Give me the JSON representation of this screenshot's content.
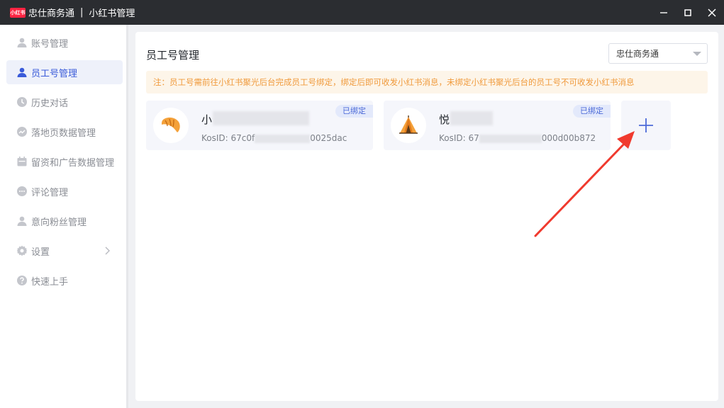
{
  "titlebar": {
    "logo_text": "小红书",
    "app_name": "忠仕商务通",
    "separator": "|",
    "subtitle": "小红书管理"
  },
  "sidebar": {
    "items": [
      {
        "label": "账号管理",
        "icon": "user-icon",
        "active": false
      },
      {
        "label": "员工号管理",
        "icon": "user-icon",
        "active": true
      },
      {
        "label": "历史对话",
        "icon": "clock-icon",
        "active": false
      },
      {
        "label": "落地页数据管理",
        "icon": "chart-icon",
        "active": false
      },
      {
        "label": "留资和广告数据管理",
        "icon": "calendar-icon",
        "active": false
      },
      {
        "label": "评论管理",
        "icon": "comment-icon",
        "active": false
      },
      {
        "label": "意向粉丝管理",
        "icon": "user-icon",
        "active": false
      },
      {
        "label": "设置",
        "icon": "gear-icon",
        "active": false
      },
      {
        "label": "快速上手",
        "icon": "help-icon",
        "active": false
      }
    ]
  },
  "main": {
    "title": "员工号管理",
    "company_select": "忠仕商务通",
    "notice": "注：员工号需前往小红书聚光后台完成员工号绑定，绑定后即可收发小红书消息，未绑定小红书聚光后台的员工号不可收发小红书消息",
    "cards": [
      {
        "name": "小",
        "kos_prefix": "KosID: 67c0f",
        "kos_suffix": "0025dac",
        "badge": "已绑定",
        "avatar": "croissant-icon"
      },
      {
        "name": "悦",
        "kos_prefix": "KosID: 67",
        "kos_suffix": "000d00b872",
        "badge": "已绑定",
        "avatar": "tent-icon"
      }
    ]
  },
  "colors": {
    "accent": "#3a5bd9",
    "notice_text": "#f09a3c",
    "notice_bg": "#fdf5e9",
    "annotation_arrow": "#f03a2e"
  }
}
